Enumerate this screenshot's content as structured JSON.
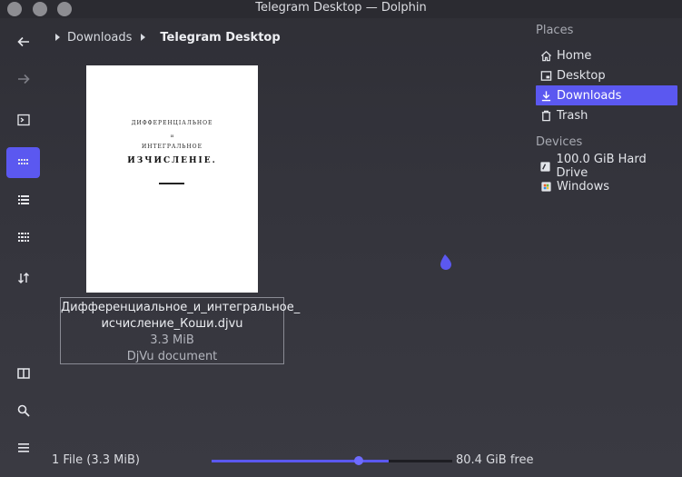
{
  "window": {
    "title": "Telegram Desktop — Dolphin"
  },
  "toolbar": {
    "items": [
      {
        "name": "back",
        "icon": "arrow-left-icon"
      },
      {
        "name": "forward",
        "icon": "arrow-right-icon",
        "disabled": true
      },
      {
        "name": "terminal",
        "icon": "terminal-icon"
      },
      {
        "name": "icons-view",
        "icon": "grid-view-icon",
        "active": true
      },
      {
        "name": "details-view",
        "icon": "list-view-icon"
      },
      {
        "name": "compact-view",
        "icon": "compact-view-icon"
      },
      {
        "name": "sort",
        "icon": "sort-icon"
      },
      {
        "name": "split",
        "icon": "split-view-icon"
      },
      {
        "name": "search",
        "icon": "search-icon"
      },
      {
        "name": "menu",
        "icon": "hamburger-menu-icon"
      }
    ]
  },
  "breadcrumb": {
    "items": [
      "Downloads",
      "Telegram Desktop"
    ]
  },
  "file": {
    "name_line1": "Дифференциальное_и_интегральное_",
    "name_line2": "исчисление_Коши.djvu",
    "size": "3.3 MiB",
    "type": "DjVu document",
    "thumbnail": {
      "line1": "ДИФФЕРЕНЦІАЛЬНОЕ",
      "line2": "и",
      "line3": "ИНТЕГРАЛЬНОЕ",
      "line4": "ИЗЧИСЛЕНІЕ."
    }
  },
  "places": {
    "title": "Places",
    "items": [
      {
        "label": "Home",
        "icon": "home-icon"
      },
      {
        "label": "Desktop",
        "icon": "desktop-icon"
      },
      {
        "label": "Downloads",
        "icon": "download-icon",
        "active": true
      },
      {
        "label": "Trash",
        "icon": "trash-icon"
      }
    ]
  },
  "devices": {
    "title": "Devices",
    "items": [
      {
        "label": "100.0 GiB Hard Drive",
        "icon": "hard-drive-icon"
      },
      {
        "label": "Windows",
        "icon": "drive-windows-icon"
      }
    ]
  },
  "status": {
    "summary": "1 File (3.3 MiB)",
    "zoom_percent": 85,
    "disk_used_fraction": 0.2,
    "free_space": "80.4 GiB free"
  },
  "colors": {
    "accent": "#5b58f0",
    "background": "#34343c"
  }
}
